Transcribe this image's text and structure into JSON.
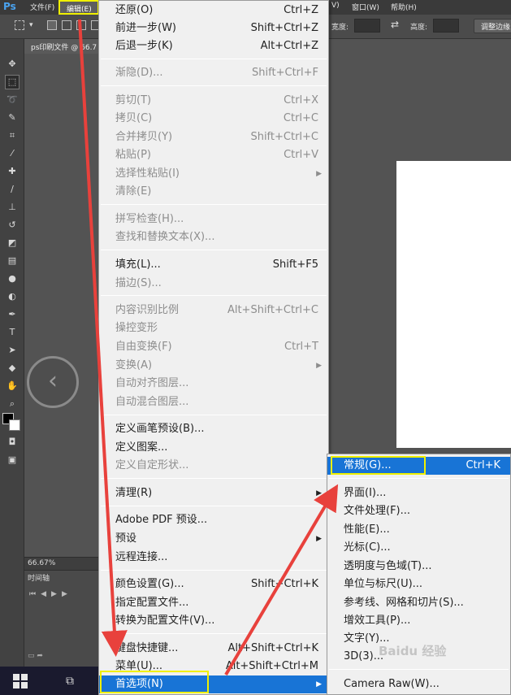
{
  "app": {
    "logo": "Ps",
    "menus": {
      "file": "文件(F)",
      "edit": "编辑(E)",
      "window_partial": "窗口(W)",
      "help": "帮助(H)",
      "partial_v": "V)"
    },
    "options_bar": {
      "width_label": "宽度:",
      "height_label": "高度:",
      "swap_symbol": "⇄",
      "adjust_button": "调整边缘..."
    },
    "document_tab": "ps印刷文件 @ 66.7",
    "status_zoom": "66.67%",
    "timeline_tab": "时间轴"
  },
  "edit_menu": {
    "items": [
      {
        "label": "还原(O)",
        "shortcut": "Ctrl+Z"
      },
      {
        "label": "前进一步(W)",
        "shortcut": "Shift+Ctrl+Z"
      },
      {
        "label": "后退一步(K)",
        "shortcut": "Alt+Ctrl+Z"
      },
      {
        "label": "渐隐(D)...",
        "shortcut": "Shift+Ctrl+F"
      },
      {
        "label": "剪切(T)",
        "shortcut": "Ctrl+X"
      },
      {
        "label": "拷贝(C)",
        "shortcut": "Ctrl+C"
      },
      {
        "label": "合并拷贝(Y)",
        "shortcut": "Shift+Ctrl+C"
      },
      {
        "label": "粘贴(P)",
        "shortcut": "Ctrl+V"
      },
      {
        "label": "选择性粘贴(I)",
        "shortcut": ""
      },
      {
        "label": "清除(E)",
        "shortcut": ""
      },
      {
        "label": "拼写检查(H)...",
        "shortcut": ""
      },
      {
        "label": "查找和替换文本(X)...",
        "shortcut": ""
      },
      {
        "label": "填充(L)...",
        "shortcut": "Shift+F5"
      },
      {
        "label": "描边(S)...",
        "shortcut": ""
      },
      {
        "label": "内容识别比例",
        "shortcut": "Alt+Shift+Ctrl+C"
      },
      {
        "label": "操控变形",
        "shortcut": ""
      },
      {
        "label": "自由变换(F)",
        "shortcut": "Ctrl+T"
      },
      {
        "label": "变换(A)",
        "shortcut": ""
      },
      {
        "label": "自动对齐图层...",
        "shortcut": ""
      },
      {
        "label": "自动混合图层...",
        "shortcut": ""
      },
      {
        "label": "定义画笔预设(B)...",
        "shortcut": ""
      },
      {
        "label": "定义图案...",
        "shortcut": ""
      },
      {
        "label": "定义自定形状...",
        "shortcut": ""
      },
      {
        "label": "清理(R)",
        "shortcut": ""
      },
      {
        "label": "Adobe PDF 预设...",
        "shortcut": ""
      },
      {
        "label": "预设",
        "shortcut": ""
      },
      {
        "label": "远程连接...",
        "shortcut": ""
      },
      {
        "label": "颜色设置(G)...",
        "shortcut": "Shift+Ctrl+K"
      },
      {
        "label": "指定配置文件...",
        "shortcut": ""
      },
      {
        "label": "转换为配置文件(V)...",
        "shortcut": ""
      },
      {
        "label": "键盘快捷键...",
        "shortcut": "Alt+Shift+Ctrl+K"
      },
      {
        "label": "菜单(U)...",
        "shortcut": "Alt+Shift+Ctrl+M"
      },
      {
        "label": "首选项(N)",
        "shortcut": ""
      }
    ]
  },
  "preferences_submenu": {
    "items": [
      {
        "label": "常规(G)...",
        "shortcut": "Ctrl+K"
      },
      {
        "label": "界面(I)...",
        "shortcut": ""
      },
      {
        "label": "文件处理(F)...",
        "shortcut": ""
      },
      {
        "label": "性能(E)...",
        "shortcut": ""
      },
      {
        "label": "光标(C)...",
        "shortcut": ""
      },
      {
        "label": "透明度与色域(T)...",
        "shortcut": ""
      },
      {
        "label": "单位与标尺(U)...",
        "shortcut": ""
      },
      {
        "label": "参考线、网格和切片(S)...",
        "shortcut": ""
      },
      {
        "label": "增效工具(P)...",
        "shortcut": ""
      },
      {
        "label": "文字(Y)...",
        "shortcut": ""
      },
      {
        "label": "3D(3)...",
        "shortcut": ""
      },
      {
        "label": "Camera Raw(W)...",
        "shortcut": ""
      }
    ]
  },
  "watermark": "Baidu 经验",
  "colors": {
    "highlight": "#1874d6",
    "annotation_box": "#f0f000",
    "annotation_arrow": "#e8413c"
  }
}
